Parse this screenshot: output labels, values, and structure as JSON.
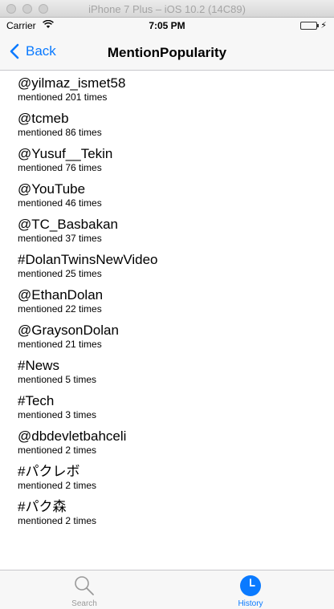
{
  "window": {
    "title": "iPhone 7 Plus – iOS 10.2 (14C89)"
  },
  "status_bar": {
    "carrier": "Carrier",
    "time": "7:05 PM"
  },
  "nav": {
    "back_label": "Back",
    "title": "MentionPopularity"
  },
  "mentions": [
    {
      "tag": "@yilmaz_ismet58",
      "count": "mentioned 201 times"
    },
    {
      "tag": "@tcmeb",
      "count": "mentioned 86 times"
    },
    {
      "tag": "@Yusuf__Tekin",
      "count": "mentioned 76 times"
    },
    {
      "tag": "@YouTube",
      "count": "mentioned 46 times"
    },
    {
      "tag": "@TC_Basbakan",
      "count": "mentioned 37 times"
    },
    {
      "tag": "#DolanTwinsNewVideo",
      "count": "mentioned 25 times"
    },
    {
      "tag": "@EthanDolan",
      "count": "mentioned 22 times"
    },
    {
      "tag": "@GraysonDolan",
      "count": "mentioned 21 times"
    },
    {
      "tag": "#News",
      "count": "mentioned 5 times"
    },
    {
      "tag": "#Tech",
      "count": "mentioned 3 times"
    },
    {
      "tag": "@dbdevletbahceli",
      "count": "mentioned 2 times"
    },
    {
      "tag": "#パクレボ",
      "count": "mentioned 2 times"
    },
    {
      "tag": "#パク森",
      "count": "mentioned 2 times"
    }
  ],
  "tab_bar": {
    "tabs": [
      {
        "label": "Search",
        "icon": "search-icon",
        "selected": false
      },
      {
        "label": "History",
        "icon": "clock-icon",
        "selected": true
      }
    ]
  },
  "colors": {
    "accent": "#0a7aff",
    "tab_inactive": "#999999",
    "battery": "#3ccb3c"
  }
}
